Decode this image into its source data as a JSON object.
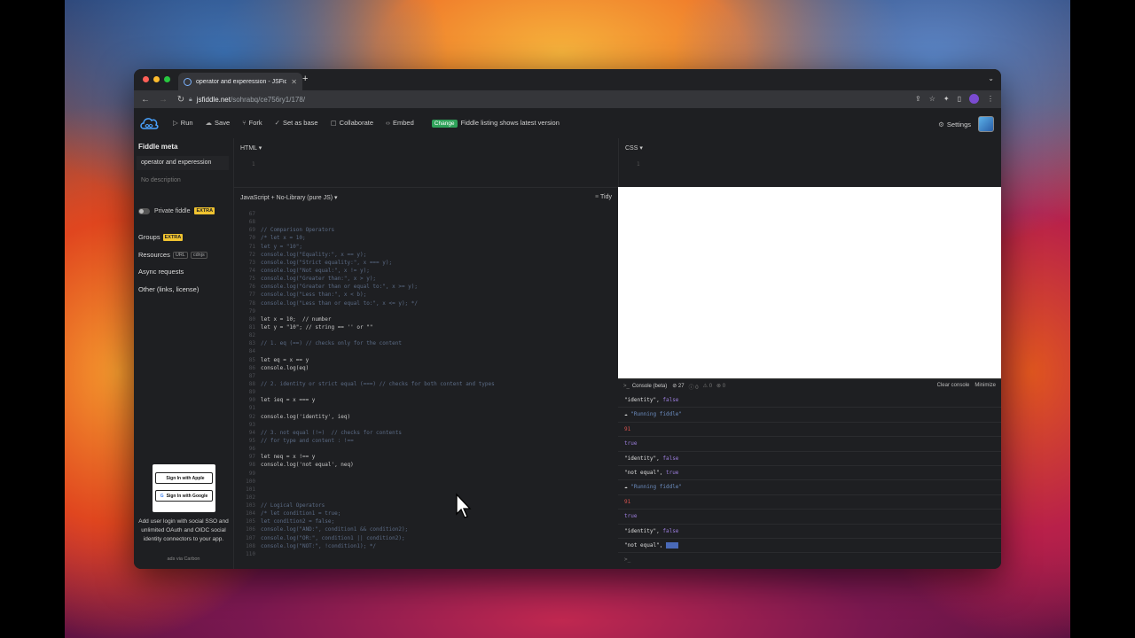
{
  "browser": {
    "tab_title": "operator and experession - JSFiddle",
    "new_tab_glyph": "+",
    "url_host": "jsfiddle.net",
    "url_path": "/sohrabq/ce756ry1/178/",
    "icons": [
      "back-icon",
      "forward-icon",
      "reload-icon",
      "lock-icon",
      "share-icon",
      "bookmark-star-icon",
      "extensions-icon",
      "sidepanel-icon",
      "profile-icon",
      "menu-icon"
    ]
  },
  "header": {
    "run": "Run",
    "save": "Save",
    "fork": "Fork",
    "set_as_base": "Set as base",
    "collaborate": "Collaborate",
    "embed": "Embed",
    "change_badge": "Change",
    "listing_note": "Fiddle listing shows latest version",
    "settings": "Settings"
  },
  "sidebar": {
    "title": "Fiddle meta",
    "fiddle_name": "operator and experession",
    "description_placeholder": "No description",
    "private_label": "Private fiddle",
    "extra_badge": "EXTRA",
    "groups": "Groups",
    "resources": "Resources",
    "resources_tags": [
      "URL",
      "cdnjs"
    ],
    "async": "Async requests",
    "other": "Other (links, license)",
    "ad": {
      "apple_btn": "Sign In with Apple",
      "google_btn": "Sign In with Google",
      "text": "Add user login with social SSO and unlimited OAuth and OIDC social identity connectors to your app.",
      "via": "ads via Carbon"
    }
  },
  "panels": {
    "html_label": "HTML ▾",
    "html_line": "1",
    "css_label": "CSS ▾",
    "css_line": "1",
    "js_label": "JavaScript + No-Library (pure JS) ▾",
    "tidy": "Tidy"
  },
  "js_code": [
    {
      "n": "67",
      "t": ""
    },
    {
      "n": "68",
      "t": ""
    },
    {
      "n": "69",
      "t": "// Comparison Operators",
      "c": "cm"
    },
    {
      "n": "70",
      "t": "/* let x = 10;",
      "c": "cm"
    },
    {
      "n": "71",
      "t": "let y = \"10\";",
      "c": "cm"
    },
    {
      "n": "72",
      "t": "console.log(\"Equality:\", x == y);",
      "c": "cm"
    },
    {
      "n": "73",
      "t": "console.log(\"Strict equality:\", x === y);",
      "c": "cm"
    },
    {
      "n": "74",
      "t": "console.log(\"Not equal:\", x != y);",
      "c": "cm"
    },
    {
      "n": "75",
      "t": "console.log(\"Greater than:\", x > y);",
      "c": "cm"
    },
    {
      "n": "76",
      "t": "console.log(\"Greater than or equal to:\", x >= y);",
      "c": "cm"
    },
    {
      "n": "77",
      "t": "console.log(\"Less than:\", x < b);",
      "c": "cm"
    },
    {
      "n": "78",
      "t": "console.log(\"Less than or equal to:\", x <= y); */",
      "c": "cm"
    },
    {
      "n": "79",
      "t": ""
    },
    {
      "n": "80",
      "t": "let x = 10;  // number"
    },
    {
      "n": "81",
      "t": "let y = \"10\"; // string == '' or \"\""
    },
    {
      "n": "82",
      "t": ""
    },
    {
      "n": "83",
      "t": "// 1. eq (==) // checks only for the content",
      "c": "cm"
    },
    {
      "n": "84",
      "t": ""
    },
    {
      "n": "85",
      "t": "let eq = x == y"
    },
    {
      "n": "86",
      "t": "console.log(eq)"
    },
    {
      "n": "87",
      "t": ""
    },
    {
      "n": "88",
      "t": "// 2. identity or strict equal (===) // checks for both content and types",
      "c": "cm"
    },
    {
      "n": "89",
      "t": ""
    },
    {
      "n": "90",
      "t": "let ieq = x === y"
    },
    {
      "n": "91",
      "t": ""
    },
    {
      "n": "92",
      "t": "console.log('identity', ieq)"
    },
    {
      "n": "93",
      "t": ""
    },
    {
      "n": "94",
      "t": "// 3. not equal (!=)  // checks for contents",
      "c": "cm"
    },
    {
      "n": "95",
      "t": "// for type and content : !==",
      "c": "cm"
    },
    {
      "n": "96",
      "t": ""
    },
    {
      "n": "97",
      "t": "let neq = x !== y"
    },
    {
      "n": "98",
      "t": "console.log('not equal', neq)"
    },
    {
      "n": "99",
      "t": ""
    },
    {
      "n": "100",
      "t": ""
    },
    {
      "n": "101",
      "t": ""
    },
    {
      "n": "102",
      "t": ""
    },
    {
      "n": "103",
      "t": "// Logical Operators",
      "c": "cm"
    },
    {
      "n": "104",
      "t": "/* let condition1 = true;",
      "c": "cm"
    },
    {
      "n": "105",
      "t": "let condition2 = false;",
      "c": "cm"
    },
    {
      "n": "106",
      "t": "console.log(\"AND:\", condition1 && condition2);",
      "c": "cm"
    },
    {
      "n": "107",
      "t": "console.log(\"OR:\", condition1 || condition2);",
      "c": "cm"
    },
    {
      "n": "108",
      "t": "console.log(\"NOT:\", !condition1); */",
      "c": "cm"
    },
    {
      "n": "110",
      "t": ""
    }
  ],
  "console": {
    "title": "Console (beta)",
    "count_log": "27",
    "count_info": "0",
    "count_warn": "0",
    "count_error": "0",
    "clear": "Clear console",
    "minimize": "Minimize",
    "entries": [
      {
        "a": "\"identity\", ",
        "b": "false",
        "cls": "f"
      },
      {
        "a": "☁ ",
        "b": "\"Running fiddle\"",
        "cls": "info"
      },
      {
        "a": "",
        "b": "91",
        "cls": "n"
      },
      {
        "a": "",
        "b": "true",
        "cls": "t"
      },
      {
        "a": "\"identity\", ",
        "b": "false",
        "cls": "f"
      },
      {
        "a": "\"not equal\", ",
        "b": "true",
        "cls": "t"
      },
      {
        "a": "☁ ",
        "b": "\"Running fiddle\"",
        "cls": "info"
      },
      {
        "a": "",
        "b": "91",
        "cls": "n"
      },
      {
        "a": "",
        "b": "true",
        "cls": "t"
      },
      {
        "a": "\"identity\", ",
        "b": "false",
        "cls": "f"
      },
      {
        "a": "\"not equal\", ",
        "b": "true",
        "cls": "hl"
      }
    ],
    "prompt": ">_"
  }
}
